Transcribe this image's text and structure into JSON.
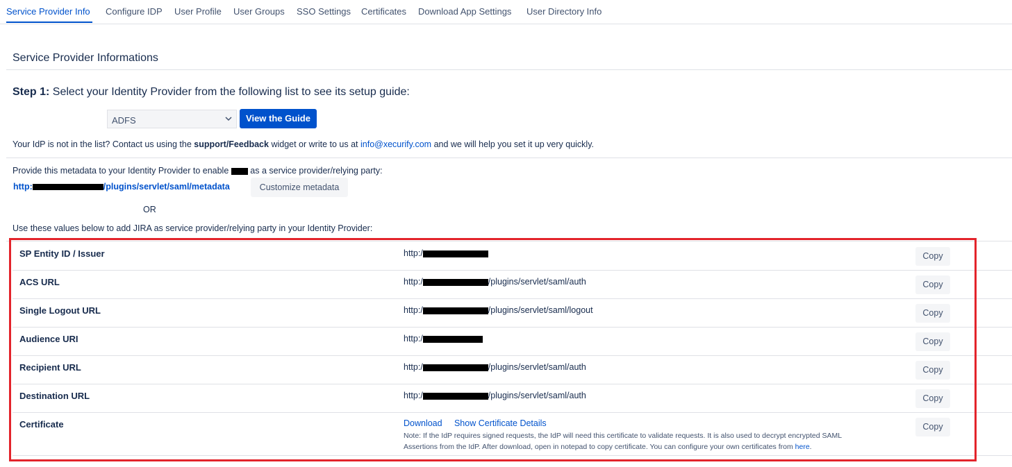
{
  "tabs": [
    {
      "label": "Service Provider Info",
      "active": true
    },
    {
      "label": "Configure IDP"
    },
    {
      "label": "User Profile"
    },
    {
      "label": "User Groups"
    },
    {
      "label": "SSO Settings"
    },
    {
      "label": "Certificates"
    },
    {
      "label": "Download App Settings"
    },
    {
      "label": "User Directory Info"
    }
  ],
  "section": {
    "title": "Service Provider Informations"
  },
  "step1": {
    "prefix": "Step 1:",
    "text": "Select your Identity Provider from the following list to see its setup guide:",
    "idp_selected": "ADFS",
    "guide_button": "View the Guide"
  },
  "contact": {
    "pre": "Your IdP is not in the list? Contact us using the",
    "widget": "support/Feedback",
    "mid": "widget or write to us at",
    "email": "info@xecurify.com",
    "post": "and we will help you set it up very quickly."
  },
  "metadata": {
    "intro_pre": "Provide this metadata to your Identity Provider to enable",
    "intro_post": "as a service provider/relying party:",
    "url_prefix": "http:",
    "url_suffix": "/plugins/servlet/saml/metadata",
    "customize_button": "Customize metadata",
    "or": "OR",
    "use_values": "Use these values below to add JIRA as service provider/relying party in your Identity Provider:"
  },
  "rows": [
    {
      "label": "SP Entity ID / Issuer",
      "prefix": "http:/",
      "suffix": "",
      "copy": "Copy"
    },
    {
      "label": "ACS URL",
      "prefix": "http:/",
      "suffix": "/plugins/servlet/saml/auth",
      "copy": "Copy"
    },
    {
      "label": "Single Logout URL",
      "prefix": "http:/",
      "suffix": "/plugins/servlet/saml/logout",
      "copy": "Copy"
    },
    {
      "label": "Audience URI",
      "prefix": "http:/",
      "suffix": "",
      "copy": "Copy"
    },
    {
      "label": "Recipient URL",
      "prefix": "http:/",
      "suffix": "/plugins/servlet/saml/auth",
      "copy": "Copy"
    },
    {
      "label": "Destination URL",
      "prefix": "http:/",
      "suffix": "/plugins/servlet/saml/auth",
      "copy": "Copy"
    }
  ],
  "certificate": {
    "label": "Certificate",
    "download": "Download",
    "show_details": "Show Certificate Details",
    "note_line1": "Note: If the IdP requires signed requests, the IdP will need this certificate to validate requests. It is also used to decrypt encrypted SAML",
    "note_line2": "Assertions from the IdP. After download, open in notepad to copy certificate. You can configure your own certificates from",
    "note_link": "here",
    "note_end": ".",
    "copy": "Copy"
  },
  "colors": {
    "accent": "#0052cc",
    "highlight": "#e3242b"
  }
}
